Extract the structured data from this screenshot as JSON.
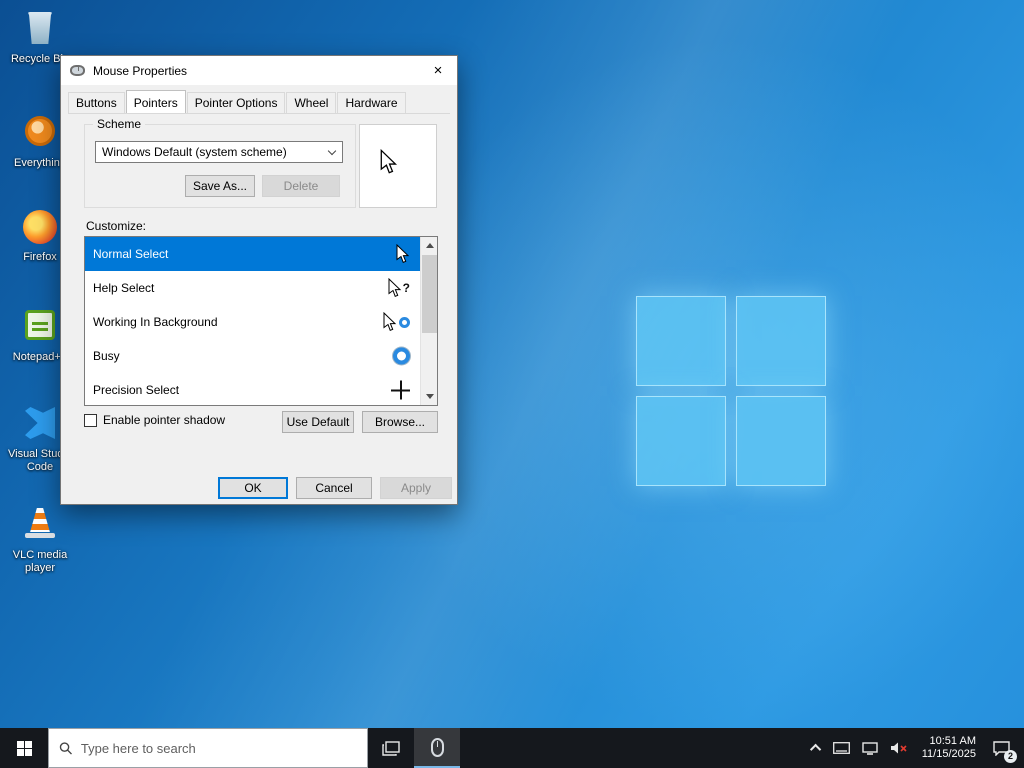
{
  "desktop": {
    "icons": [
      {
        "label": "Recycle Bin"
      },
      {
        "label": "Everything"
      },
      {
        "label": "Firefox"
      },
      {
        "label": "Notepad++"
      },
      {
        "label": "Visual Studio Code"
      },
      {
        "label": "VLC media player"
      }
    ]
  },
  "dialog": {
    "title": "Mouse Properties",
    "close_label": "×",
    "tabs": [
      {
        "label": "Buttons"
      },
      {
        "label": "Pointers"
      },
      {
        "label": "Pointer Options"
      },
      {
        "label": "Wheel"
      },
      {
        "label": "Hardware"
      }
    ],
    "scheme": {
      "group_label": "Scheme",
      "selected_value": "Windows Default (system scheme)",
      "save_as_label": "Save As...",
      "delete_label": "Delete"
    },
    "customize_label": "Customize:",
    "pointer_list": [
      {
        "label": "Normal Select",
        "cursor": "arrow-cursor",
        "selected": true
      },
      {
        "label": "Help Select",
        "cursor": "help-cursor",
        "selected": false
      },
      {
        "label": "Working In Background",
        "cursor": "working-cursor",
        "selected": false
      },
      {
        "label": "Busy",
        "cursor": "busy-cursor",
        "selected": false
      },
      {
        "label": "Precision Select",
        "cursor": "precision-cursor",
        "selected": false
      }
    ],
    "shadow_label": "Enable pointer shadow",
    "use_default_label": "Use Default",
    "browse_label": "Browse...",
    "ok_label": "OK",
    "cancel_label": "Cancel",
    "apply_label": "Apply"
  },
  "taskbar": {
    "search_placeholder": "Type here to search",
    "clock": {
      "time": "10:51 AM",
      "date": "11/15/2025"
    },
    "notification_badge": "2"
  },
  "colors": {
    "selection": "#0078d7",
    "taskbar": "#15181d",
    "logo_blue": "#5fc6f5"
  }
}
